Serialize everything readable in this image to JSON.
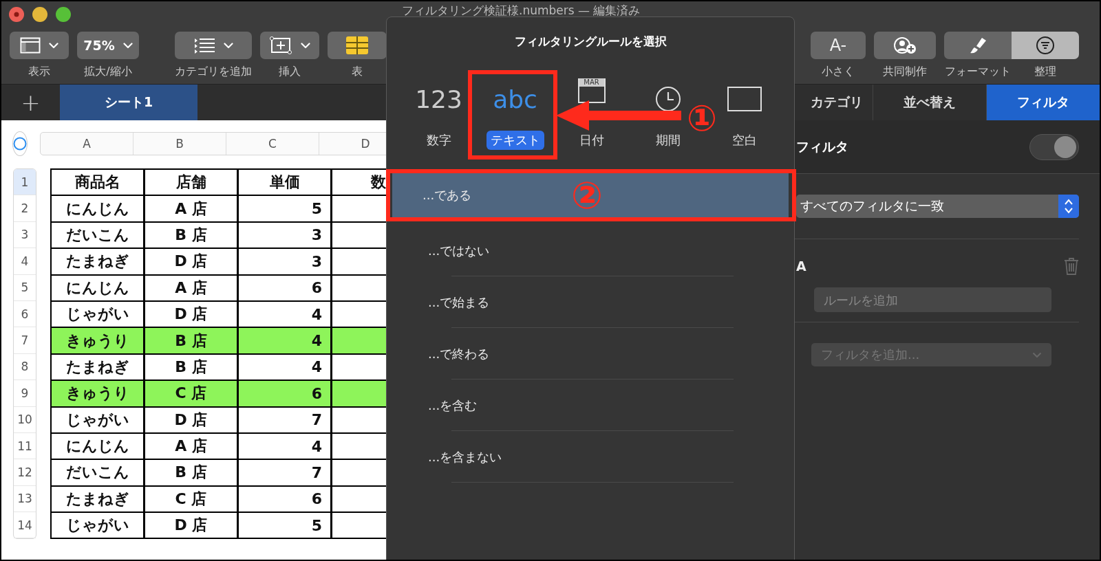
{
  "window": {
    "title": "フィルタリング検証様.numbers — 編集済み"
  },
  "toolbar": {
    "left": [
      {
        "kind": "view",
        "label": "表示"
      },
      {
        "kind": "zoom",
        "value": "75%",
        "label": "拡大/縮小"
      },
      {
        "kind": "category",
        "label": "カテゴリを追加"
      },
      {
        "kind": "insert",
        "label": "挿入"
      },
      {
        "kind": "table",
        "label": "表"
      }
    ],
    "right": [
      {
        "kind": "smaller",
        "value": "A-",
        "label": "小さく"
      },
      {
        "kind": "collab",
        "label": "共同制作"
      },
      {
        "kind": "format",
        "label": "フォーマット",
        "selected": false
      },
      {
        "kind": "organize",
        "label": "整理",
        "selected": true
      }
    ]
  },
  "add_sheet": "+",
  "sheet_tabs": [
    {
      "label": "シート1",
      "selected": true
    }
  ],
  "sheet": {
    "columns": [
      "A",
      "B",
      "C",
      "D"
    ],
    "rows": [
      {
        "number": "1",
        "selected": true,
        "highlighted": false,
        "cells": [
          "商品名",
          "店舗",
          "単価",
          "数"
        ]
      },
      {
        "number": "2",
        "selected": false,
        "highlighted": false,
        "cells": [
          "にんじん",
          "A 店",
          "5"
        ]
      },
      {
        "number": "3",
        "selected": false,
        "highlighted": false,
        "cells": [
          "だいこん",
          "B 店",
          "3"
        ]
      },
      {
        "number": "4",
        "selected": false,
        "highlighted": false,
        "cells": [
          "たまねぎ",
          "D 店",
          "3"
        ]
      },
      {
        "number": "5",
        "selected": false,
        "highlighted": false,
        "cells": [
          "にんじん",
          "A 店",
          "6"
        ]
      },
      {
        "number": "6",
        "selected": false,
        "highlighted": false,
        "cells": [
          "じゃがい",
          "D 店",
          "4"
        ]
      },
      {
        "number": "7",
        "selected": false,
        "highlighted": true,
        "cells": [
          "きゅうり",
          "B 店",
          "4"
        ]
      },
      {
        "number": "8",
        "selected": false,
        "highlighted": false,
        "cells": [
          "たまねぎ",
          "B 店",
          "4"
        ]
      },
      {
        "number": "9",
        "selected": false,
        "highlighted": true,
        "cells": [
          "きゅうり",
          "C 店",
          "6"
        ]
      },
      {
        "number": "10",
        "selected": false,
        "highlighted": false,
        "cells": [
          "じゃがい",
          "D 店",
          "7"
        ]
      },
      {
        "number": "11",
        "selected": false,
        "highlighted": false,
        "cells": [
          "にんじん",
          "A 店",
          "4"
        ]
      },
      {
        "number": "12",
        "selected": false,
        "highlighted": false,
        "cells": [
          "だいこん",
          "B 店",
          "7"
        ]
      },
      {
        "number": "13",
        "selected": false,
        "highlighted": false,
        "cells": [
          "たまねぎ",
          "C 店",
          "6"
        ]
      },
      {
        "number": "14",
        "selected": false,
        "highlighted": false,
        "cells": [
          "じゃがい",
          "D 店",
          "5"
        ]
      }
    ]
  },
  "popover": {
    "title": "フィルタリングルールを選択",
    "types": [
      {
        "kind": "number",
        "glyph": "123",
        "label": "数字",
        "selected": false
      },
      {
        "kind": "text",
        "glyph": "abc",
        "label": "テキスト",
        "selected": true
      },
      {
        "kind": "date",
        "glyph": "MAR",
        "label": "日付",
        "selected": false
      },
      {
        "kind": "duration",
        "label": "期間",
        "selected": false
      },
      {
        "kind": "blank",
        "label": "空白",
        "selected": false
      }
    ],
    "rules": [
      {
        "label": "...である",
        "selected": true
      },
      {
        "label": "...ではない",
        "selected": false
      },
      {
        "label": "...で始まる",
        "selected": false
      },
      {
        "label": "...で終わる",
        "selected": false
      },
      {
        "label": "...を含む",
        "selected": false
      },
      {
        "label": "...を含まない",
        "selected": false
      }
    ]
  },
  "inspector": {
    "tabs": [
      {
        "label": "カテゴリ",
        "selected": false
      },
      {
        "label": "並べ替え",
        "selected": false
      },
      {
        "label": "フィルタ",
        "selected": true
      }
    ],
    "filter_title": "フィルタ",
    "filter_toggle": {
      "on": true,
      "disabled": true
    },
    "match": "すべてのフィルタに一致",
    "column": "A",
    "rule_placeholder": "ルールを追加",
    "add_filter": "フィルタを追加..."
  },
  "annotations": [
    {
      "label": "①"
    },
    {
      "label": "②"
    }
  ]
}
